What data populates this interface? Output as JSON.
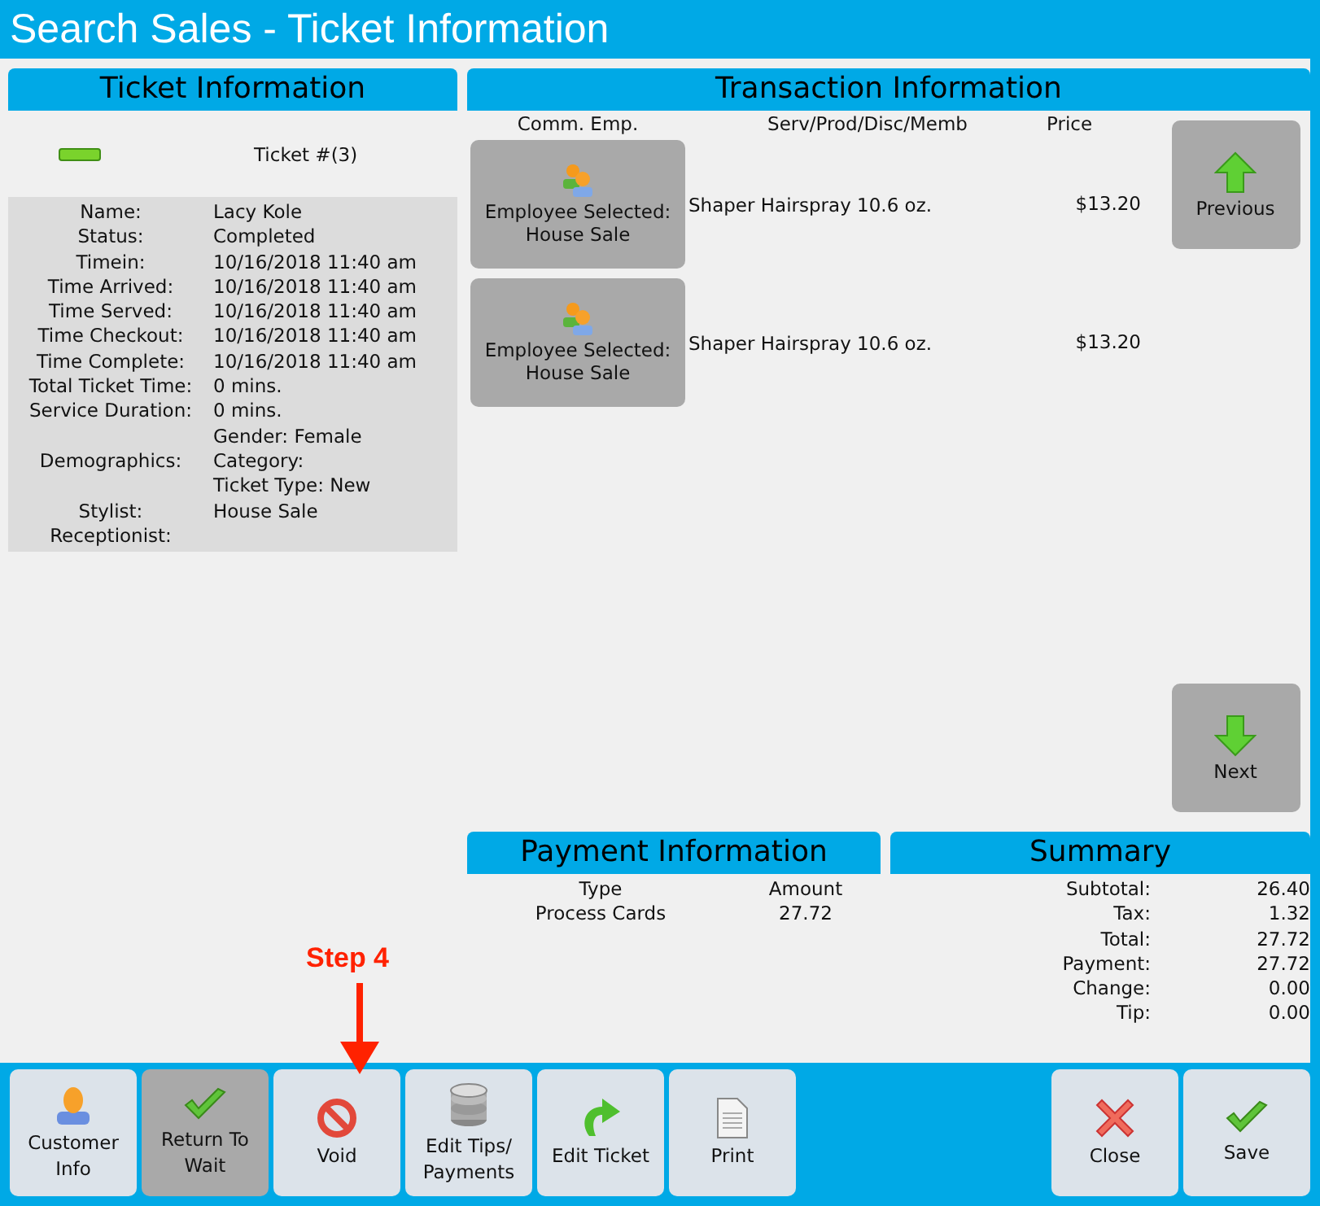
{
  "window": {
    "title": "Search Sales - Ticket Information"
  },
  "ticket_panel": {
    "title": "Ticket Information",
    "ticket_number": "Ticket #(3)",
    "fields": [
      {
        "label": "Name:",
        "values": [
          "Lacy Kole"
        ]
      },
      {
        "label": "Status:",
        "values": [
          "Completed"
        ]
      },
      {
        "label": "Timein:",
        "values": [
          "10/16/2018 11:40 am"
        ]
      },
      {
        "label": "Time Arrived:",
        "values": [
          "10/16/2018 11:40 am"
        ]
      },
      {
        "label": "Time Served:",
        "values": [
          "10/16/2018 11:40 am"
        ]
      },
      {
        "label": "Time Checkout:",
        "values": [
          "10/16/2018 11:40 am"
        ]
      },
      {
        "label": "Time Complete:",
        "values": [
          "10/16/2018 11:40 am"
        ]
      },
      {
        "label": "Total Ticket Time:",
        "values": [
          "0 mins."
        ]
      },
      {
        "label": "Service Duration:",
        "values": [
          "0 mins."
        ]
      },
      {
        "label": "Demographics:",
        "values": [
          "Gender: Female",
          "Category:",
          "Ticket Type: New"
        ]
      },
      {
        "label": "Stylist:",
        "values": [
          "House Sale"
        ]
      },
      {
        "label": "Receptionist:"
      }
    ]
  },
  "transaction_panel": {
    "title": "Transaction Information",
    "columns": [
      "Comm. Emp.",
      "Serv/Prod/Disc/Memb",
      "Price"
    ],
    "rows": [
      {
        "employee": [
          "Employee Selected:",
          "House Sale"
        ],
        "item": "Shaper Hairspray 10.6 oz.",
        "price": "$13.20"
      },
      {
        "employee": [
          "Employee Selected:",
          "House Sale"
        ],
        "item": "Shaper Hairspray 10.6 oz.",
        "price": "$13.20"
      }
    ],
    "previous_button": "Previous",
    "next_button": "Next"
  },
  "payment_panel": {
    "title": "Payment Information",
    "columns": [
      "Type",
      "Amount"
    ],
    "rows": [
      {
        "type": "Process Cards",
        "amount": "27.72"
      }
    ]
  },
  "summary_panel": {
    "title": "Summary",
    "rows": [
      {
        "label": "Subtotal:",
        "value": "26.40"
      },
      {
        "label": "Tax:",
        "value": "1.32"
      },
      {
        "label": "Total:",
        "value": "27.72"
      },
      {
        "label": "Payment:",
        "value": "27.72"
      },
      {
        "label": "Change:",
        "value": "0.00"
      },
      {
        "label": "Tip:",
        "value": "0.00"
      }
    ]
  },
  "annotation": {
    "label": "Step 4"
  },
  "toolbar": {
    "left": [
      {
        "kind": "customer",
        "label": [
          "Customer",
          "Info"
        ],
        "selected": false
      },
      {
        "kind": "check",
        "label": [
          "Return To",
          "Wait"
        ],
        "selected": true
      },
      {
        "kind": "void",
        "label": [
          "Void"
        ],
        "selected": false
      },
      {
        "kind": "database",
        "label": [
          "Edit Tips/",
          "Payments"
        ],
        "selected": false
      },
      {
        "kind": "redo",
        "label": [
          "Edit Ticket"
        ],
        "selected": false
      },
      {
        "kind": "document",
        "label": [
          "Print"
        ],
        "selected": false
      }
    ],
    "right": [
      {
        "kind": "close",
        "label": [
          "Close"
        ],
        "selected": false
      },
      {
        "kind": "check",
        "label": [
          "Save"
        ],
        "selected": false
      }
    ]
  }
}
